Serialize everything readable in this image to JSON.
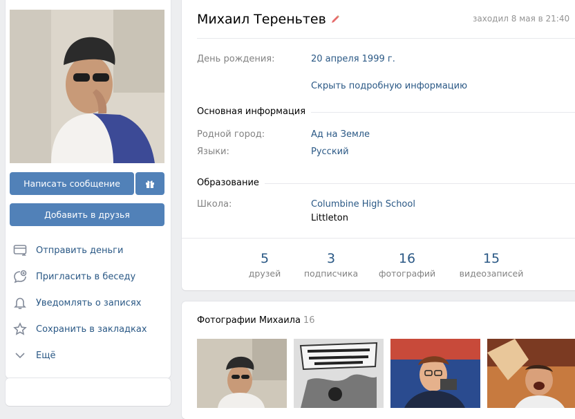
{
  "profile": {
    "name": "Михаил Тереньтев",
    "last_seen": "заходил 8 мая в 21:40"
  },
  "actions": {
    "write_message": "Написать сообщение",
    "add_friend": "Добавить в друзья"
  },
  "menu": {
    "items": [
      {
        "label": "Отправить деньги",
        "icon": "money-card-icon"
      },
      {
        "label": "Пригласить в беседу",
        "icon": "invite-chat-icon"
      },
      {
        "label": "Уведомлять о записях",
        "icon": "bell-icon"
      },
      {
        "label": "Сохранить в закладках",
        "icon": "star-icon"
      },
      {
        "label": "Ещё",
        "icon": "chevron-down-icon"
      }
    ]
  },
  "info": {
    "birthday_label": "День рождения:",
    "birthday_value": "20 апреля 1999 г.",
    "hide_details": "Скрыть подробную информацию",
    "basic_section": "Основная информация",
    "hometown_label": "Родной город:",
    "hometown_value": "Ад на Земле",
    "languages_label": "Языки:",
    "languages_value": "Русский",
    "education_section": "Образование",
    "school_label": "Школа:",
    "school_value": "Columbine High School",
    "school_city": "Littleton"
  },
  "counters": [
    {
      "num": "5",
      "label": "друзей"
    },
    {
      "num": "3",
      "label": "подписчика"
    },
    {
      "num": "16",
      "label": "фотографий"
    },
    {
      "num": "15",
      "label": "видеозаписей"
    }
  ],
  "photos": {
    "title": "Фотографии Михаила",
    "count": "16"
  },
  "colors": {
    "accent": "#5181b8",
    "link": "#2a5885",
    "background": "#edeef0"
  }
}
